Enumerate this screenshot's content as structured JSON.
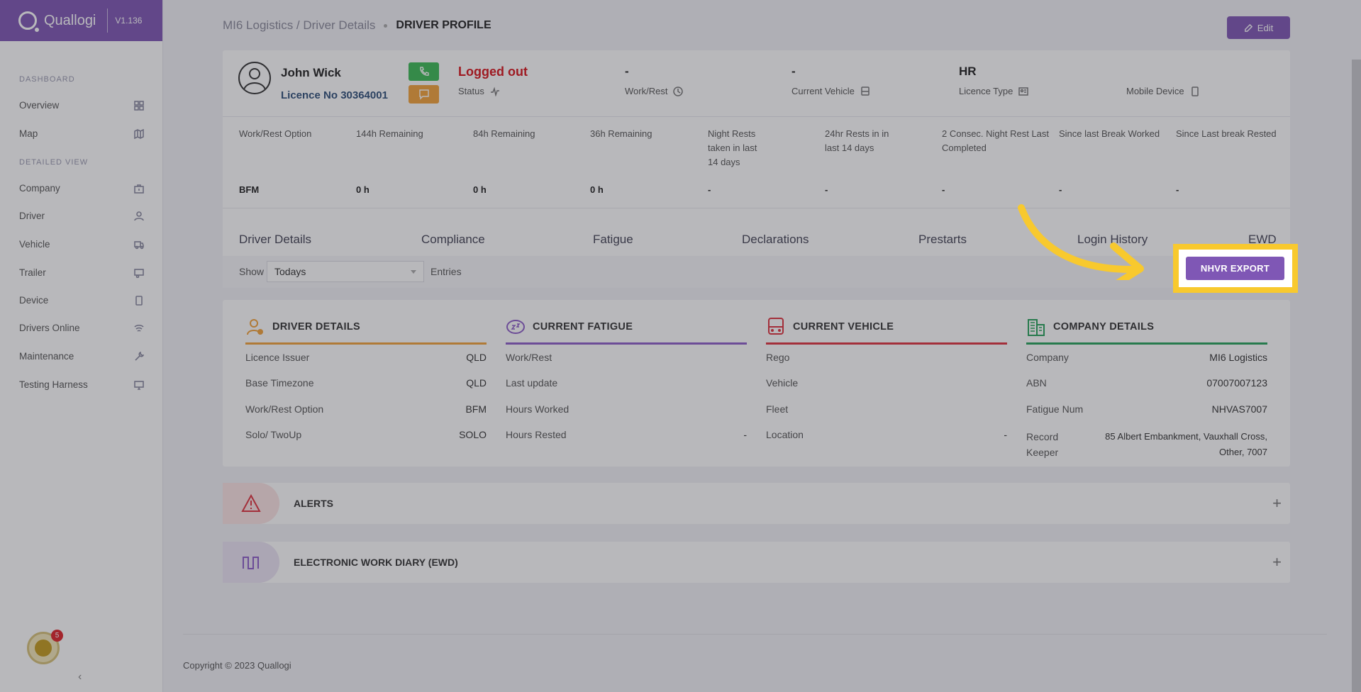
{
  "brand": {
    "name": "Quallogi",
    "version": "V1.136"
  },
  "sidebar": {
    "section_dashboard": "DASHBOARD",
    "section_detailed": "DETAILED VIEW",
    "items": [
      {
        "label": "Overview",
        "icon": "grid-icon"
      },
      {
        "label": "Map",
        "icon": "map-icon"
      },
      {
        "label": "Company",
        "icon": "building-icon"
      },
      {
        "label": "Driver",
        "icon": "user-icon"
      },
      {
        "label": "Vehicle",
        "icon": "truck-icon"
      },
      {
        "label": "Trailer",
        "icon": "trailer-icon"
      },
      {
        "label": "Device",
        "icon": "phone-icon"
      },
      {
        "label": "Drivers Online",
        "icon": "wifi-icon"
      },
      {
        "label": "Maintenance",
        "icon": "wrench-icon"
      },
      {
        "label": "Testing Harness",
        "icon": "monitor-icon"
      }
    ],
    "notification_count": "5",
    "collapse": "‹"
  },
  "header": {
    "breadcrumb": "MI6 Logistics / Driver Details",
    "page_title": "DRIVER PROFILE",
    "edit_label": "Edit"
  },
  "profile": {
    "name": "John Wick",
    "licence": "Licence No 30364001",
    "status_value": "Logged out",
    "status_label": "Status",
    "work_rest_value": "-",
    "work_rest_label": "Work/Rest",
    "vehicle_value": "-",
    "vehicle_label": "Current Vehicle",
    "licence_type_value": "HR",
    "licence_type_label": "Licence Type",
    "mobile_value": "",
    "mobile_label": "Mobile Device"
  },
  "stats": {
    "headers": [
      "Work/Rest Option",
      "144h Remaining",
      "84h Remaining",
      "36h Remaining",
      "Night Rests taken in last 14 days",
      "24hr Rests in in last 14 days",
      "2 Consec. Night Rest Last Completed",
      "Since last Break Worked",
      "Since Last break Rested"
    ],
    "values": [
      "BFM",
      "0 h",
      "0 h",
      "0 h",
      "-",
      "-",
      "-",
      "-",
      "-"
    ]
  },
  "tabs": [
    "Driver Details",
    "Compliance",
    "Fatigue",
    "Declarations",
    "Prestarts",
    "Login History",
    "EWD"
  ],
  "filter": {
    "show": "Show",
    "selected": "Todays",
    "entries": "Entries",
    "export": "NHVR EXPORT"
  },
  "details": {
    "driver": {
      "title": "DRIVER DETAILS",
      "color": "#f3a33b",
      "rows": [
        [
          "Licence Issuer",
          "QLD"
        ],
        [
          "Base Timezone",
          "QLD"
        ],
        [
          "Work/Rest Option",
          "BFM"
        ],
        [
          "Solo/ TwoUp",
          "SOLO"
        ]
      ]
    },
    "fatigue": {
      "title": "CURRENT FATIGUE",
      "color": "#8e5ec9",
      "rows": [
        [
          "Work/Rest",
          ""
        ],
        [
          "Last update",
          ""
        ],
        [
          "Hours Worked",
          ""
        ],
        [
          "Hours Rested",
          "-"
        ]
      ]
    },
    "vehicle": {
      "title": "CURRENT VEHICLE",
      "color": "#e0343f",
      "rows": [
        [
          "Rego",
          ""
        ],
        [
          "Vehicle",
          ""
        ],
        [
          "Fleet",
          ""
        ],
        [
          "Location",
          "-"
        ]
      ]
    },
    "company": {
      "title": "COMPANY DETAILS",
      "color": "#27a35c",
      "rows": [
        [
          "Company",
          "MI6 Logistics"
        ],
        [
          "ABN",
          "07007007123"
        ],
        [
          "Fatigue Num",
          "NHVAS7007"
        ],
        [
          "Record Keeper",
          "85 Albert Embankment, Vauxhall Cross, Other, 7007"
        ]
      ]
    }
  },
  "accordions": [
    {
      "title": "ALERTS",
      "icon": "warning-icon"
    },
    {
      "title": "ELECTRONIC WORK DIARY (EWD)",
      "icon": "ewd-icon"
    }
  ],
  "footer": {
    "copyright": "Copyright © 2023 Quallogi"
  }
}
